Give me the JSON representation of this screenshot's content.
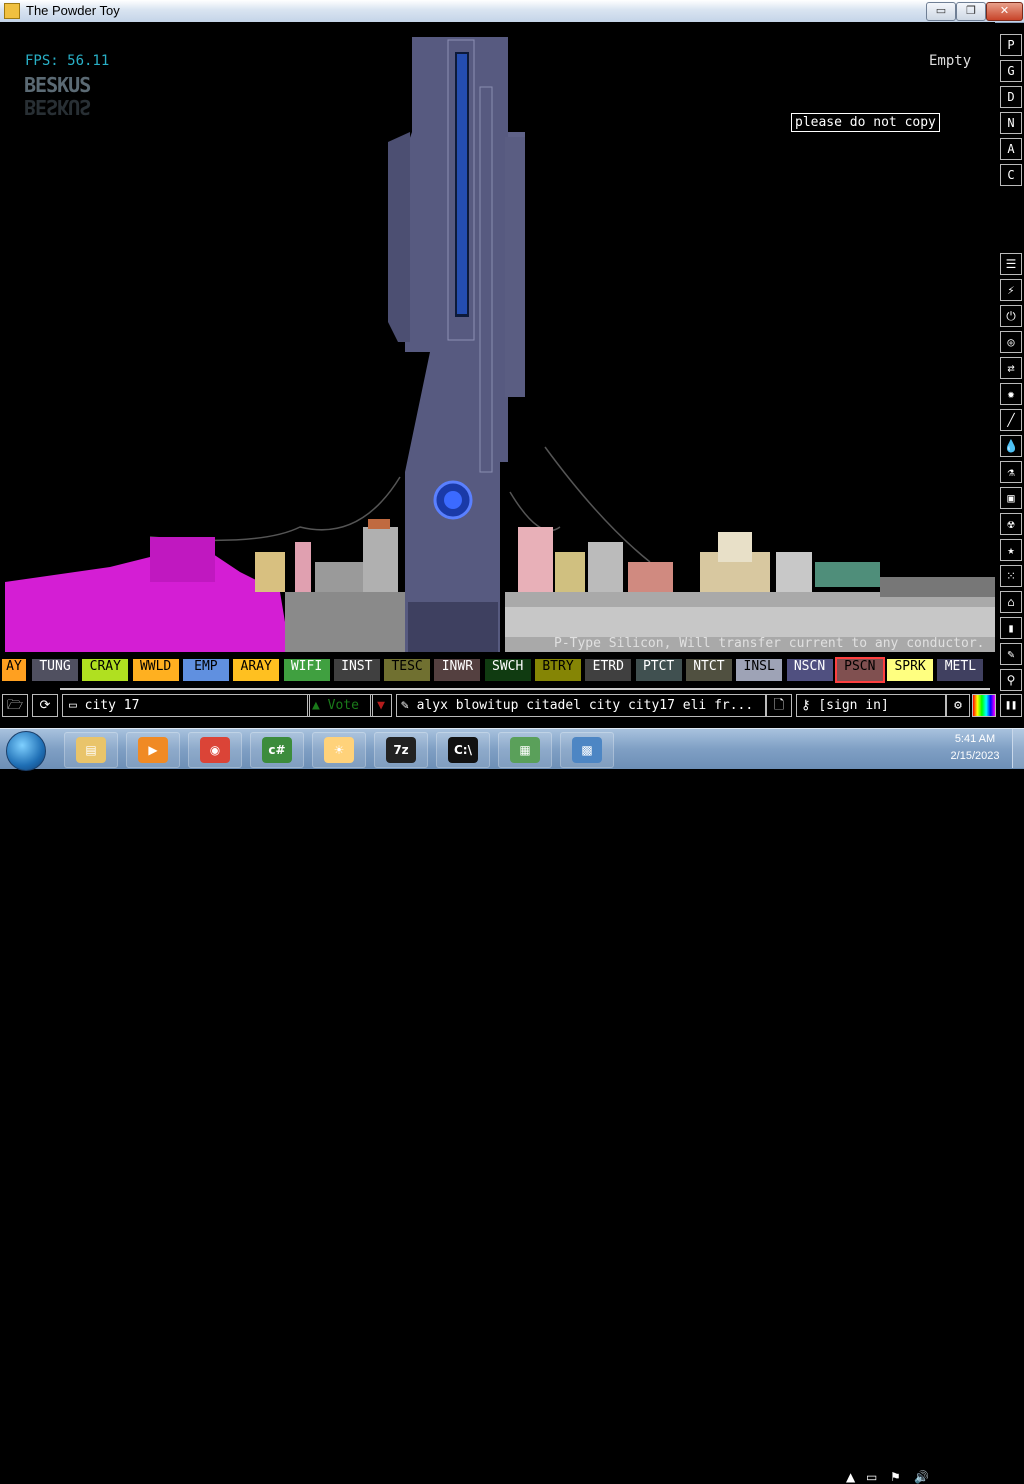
{
  "window": {
    "title": "The Powder Toy",
    "minimize": "▭",
    "maximize": "❐",
    "close": "✕"
  },
  "sim": {
    "fps": "FPS: 56.11",
    "save_tag_top": "BESKUS",
    "save_tag_mirror": "BESKUS",
    "hover_status": "Empty",
    "sign_text": "please do not copy",
    "element_description": "P-Type Silicon, Will transfer current to any conductor."
  },
  "side_top": [
    {
      "label": "P",
      "name": "pause-toggle-button"
    },
    {
      "label": "G",
      "name": "gravity-button"
    },
    {
      "label": "D",
      "name": "decorations-button"
    },
    {
      "label": "N",
      "name": "newtonian-gravity-button"
    },
    {
      "label": "A",
      "name": "ambient-heat-button"
    },
    {
      "label": "C",
      "name": "console-button"
    }
  ],
  "side_categories": [
    {
      "icon": "☰",
      "name": "category-walls-icon"
    },
    {
      "icon": "⚡",
      "name": "category-electronics-icon"
    },
    {
      "icon": "⏻",
      "name": "category-powered-icon"
    },
    {
      "icon": "◎",
      "name": "category-sensors-icon"
    },
    {
      "icon": "⇄",
      "name": "category-force-icon"
    },
    {
      "icon": "✹",
      "name": "category-explosives-icon"
    },
    {
      "icon": "╱",
      "name": "category-gases-icon"
    },
    {
      "icon": "💧",
      "name": "category-liquids-icon"
    },
    {
      "icon": "⚗",
      "name": "category-powders-icon"
    },
    {
      "icon": "▣",
      "name": "category-solids-icon"
    },
    {
      "icon": "☢",
      "name": "category-radioactive-icon"
    },
    {
      "icon": "★",
      "name": "category-special-icon"
    },
    {
      "icon": "⁙",
      "name": "category-life-icon"
    },
    {
      "icon": "⌂",
      "name": "category-tools-icon"
    },
    {
      "icon": "▮",
      "name": "category-favorites-icon"
    },
    {
      "icon": "✎",
      "name": "category-decoration-icon"
    },
    {
      "icon": "⚲",
      "name": "search-icon"
    }
  ],
  "elements": [
    {
      "label": "AY",
      "bg": "#ffa020",
      "fg": "#000"
    },
    {
      "label": "TUNG",
      "bg": "#505060",
      "fg": "#fff"
    },
    {
      "label": "CRAY",
      "bg": "#b0e020",
      "fg": "#000"
    },
    {
      "label": "WWLD",
      "bg": "#ffb020",
      "fg": "#000"
    },
    {
      "label": "EMP",
      "bg": "#6090e0",
      "fg": "#000"
    },
    {
      "label": "ARAY",
      "bg": "#ffc020",
      "fg": "#000"
    },
    {
      "label": "WIFI",
      "bg": "#40a040",
      "fg": "#fff"
    },
    {
      "label": "INST",
      "bg": "#404040",
      "fg": "#fff"
    },
    {
      "label": "TESC",
      "bg": "#707030",
      "fg": "#000"
    },
    {
      "label": "INWR",
      "bg": "#544040",
      "fg": "#fff"
    },
    {
      "label": "SWCH",
      "bg": "#103b11",
      "fg": "#fff"
    },
    {
      "label": "BTRY",
      "bg": "#858505",
      "fg": "#000"
    },
    {
      "label": "ETRD",
      "bg": "#404040",
      "fg": "#fff"
    },
    {
      "label": "PTCT",
      "bg": "#405050",
      "fg": "#fff"
    },
    {
      "label": "NTCT",
      "bg": "#505040",
      "fg": "#fff"
    },
    {
      "label": "INSL",
      "bg": "#9ea3b6",
      "fg": "#000"
    },
    {
      "label": "NSCN",
      "bg": "#505080",
      "fg": "#fff"
    },
    {
      "label": "PSCN",
      "bg": "#805050",
      "fg": "#000"
    },
    {
      "label": "SPRK",
      "bg": "#ffff80",
      "fg": "#000"
    },
    {
      "label": "METL",
      "bg": "#404060",
      "fg": "#fff"
    }
  ],
  "bottom": {
    "open_icon": "🗁",
    "reload_icon": "⟳",
    "save_name": "city 17",
    "vote_label": "Vote",
    "vote_up": "▲",
    "vote_down": "▼",
    "tags": "alyx blowitup citadel city city17 eli fr...",
    "new_icon": "🗋",
    "sign_in": "[sign in]",
    "login_icon": "⚷",
    "settings_icon": "⚙",
    "pause_icon": "❚❚"
  },
  "taskbar": {
    "apps": [
      {
        "name": "taskbar-explorer",
        "label": "▤",
        "bg": "#e9c46a"
      },
      {
        "name": "taskbar-media-player",
        "label": "▶",
        "bg": "#f08a24"
      },
      {
        "name": "taskbar-chrome",
        "label": "◉",
        "bg": "#db4437"
      },
      {
        "name": "taskbar-csharp",
        "label": "c#",
        "bg": "#3c8c3c"
      },
      {
        "name": "taskbar-powder-toy",
        "label": "☀",
        "bg": "#ffd27a"
      },
      {
        "name": "taskbar-7zip",
        "label": "7z",
        "bg": "#222"
      },
      {
        "name": "taskbar-cmd",
        "label": "C:\\",
        "bg": "#111"
      },
      {
        "name": "taskbar-network",
        "label": "▦",
        "bg": "#5aa05a"
      },
      {
        "name": "taskbar-control-panel",
        "label": "▩",
        "bg": "#4d86c4"
      }
    ],
    "tray_arrow": "▲",
    "tray_network": "▭",
    "tray_flag": "⚑",
    "tray_volume": "🔊",
    "time": "5:41 AM",
    "date": "2/15/2023"
  }
}
